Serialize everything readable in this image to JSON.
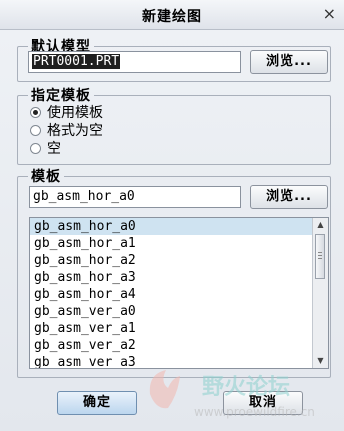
{
  "window": {
    "title": "新建绘图",
    "close_glyph": "×"
  },
  "default_model": {
    "legend": "默认模型",
    "value": "PRT0001.PRT",
    "browse_label": "浏览..."
  },
  "template_mode": {
    "legend": "指定模板",
    "options": [
      {
        "label": "使用模板",
        "selected": true
      },
      {
        "label": "格式为空",
        "selected": false
      },
      {
        "label": "空",
        "selected": false
      }
    ]
  },
  "template": {
    "legend": "模板",
    "value": "gb_asm_hor_a0",
    "browse_label": "浏览...",
    "items": [
      "gb_asm_hor_a0",
      "gb_asm_hor_a1",
      "gb_asm_hor_a2",
      "gb_asm_hor_a3",
      "gb_asm_hor_a4",
      "gb_asm_ver_a0",
      "gb_asm_ver_a1",
      "gb_asm_ver_a2",
      "gb_asm_ver_a3"
    ],
    "selected_index": 0
  },
  "footer": {
    "ok_label": "确定",
    "cancel_label": "取消"
  },
  "watermark": {
    "text_cn": "野火论坛",
    "text_url": "www.proewildfire.cn"
  }
}
